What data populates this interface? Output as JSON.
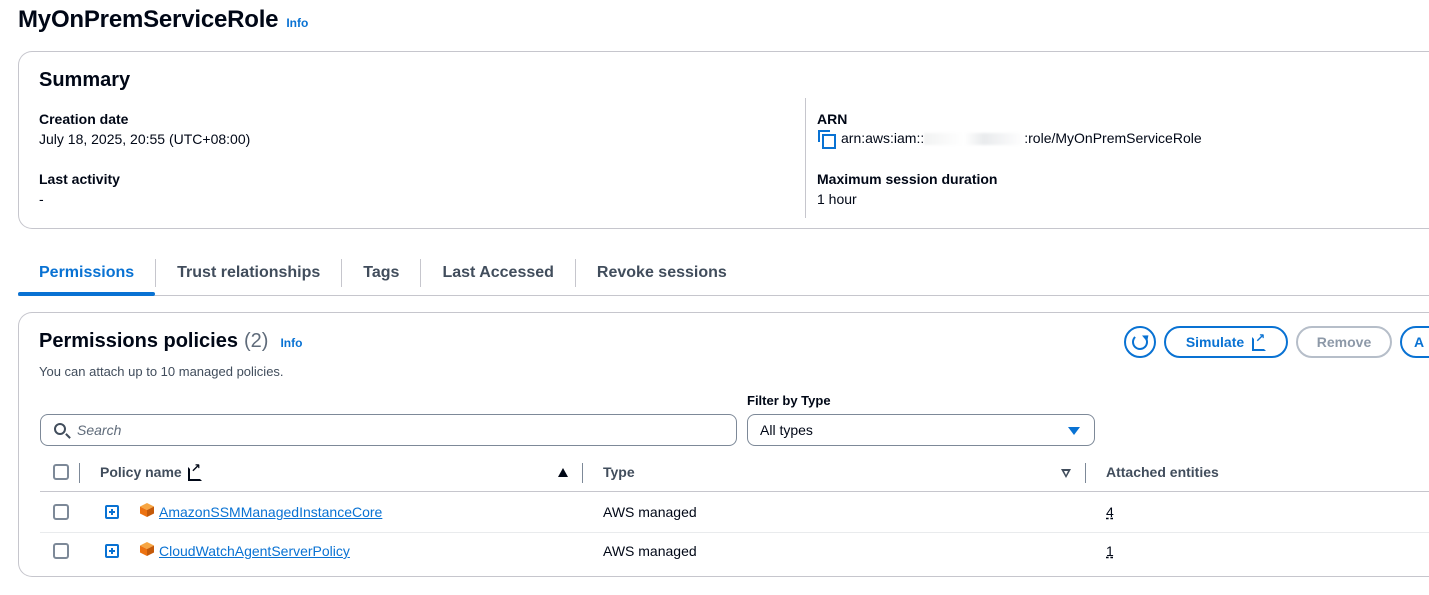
{
  "header": {
    "title": "MyOnPremServiceRole",
    "info": "Info"
  },
  "summary": {
    "title": "Summary",
    "creation_date_label": "Creation date",
    "creation_date_value": "July 18, 2025, 20:55 (UTC+08:00)",
    "last_activity_label": "Last activity",
    "last_activity_value": "-",
    "arn_label": "ARN",
    "arn_prefix": "arn:aws:iam::",
    "arn_suffix": ":role/MyOnPremServiceRole",
    "max_session_label": "Maximum session duration",
    "max_session_value": "1 hour"
  },
  "tabs": [
    {
      "label": "Permissions",
      "active": true
    },
    {
      "label": "Trust relationships"
    },
    {
      "label": "Tags"
    },
    {
      "label": "Last Accessed"
    },
    {
      "label": "Revoke sessions"
    }
  ],
  "permissions": {
    "title": "Permissions policies",
    "count": "(2)",
    "info": "Info",
    "description": "You can attach up to 10 managed policies.",
    "buttons": {
      "simulate": "Simulate",
      "remove": "Remove",
      "add": "A"
    },
    "search_placeholder": "Search",
    "filter_label": "Filter by Type",
    "filter_value": "All types",
    "columns": {
      "policy_name": "Policy name",
      "type": "Type",
      "attached": "Attached entities"
    },
    "rows": [
      {
        "name": "AmazonSSMManagedInstanceCore",
        "type": "AWS managed",
        "attached": "4"
      },
      {
        "name": "CloudWatchAgentServerPolicy",
        "type": "AWS managed",
        "attached": "1"
      }
    ]
  },
  "colors": {
    "accent": "#0972d3",
    "border": "#c6c6cd",
    "text": "#000716",
    "aws_orange": "#ec7211"
  },
  "icons": [
    "copy-icon",
    "refresh-icon",
    "external-link-icon",
    "search-icon",
    "caret-down-icon",
    "sort-up-icon",
    "sort-down-icon",
    "expand-icon",
    "aws-cube-icon"
  ]
}
